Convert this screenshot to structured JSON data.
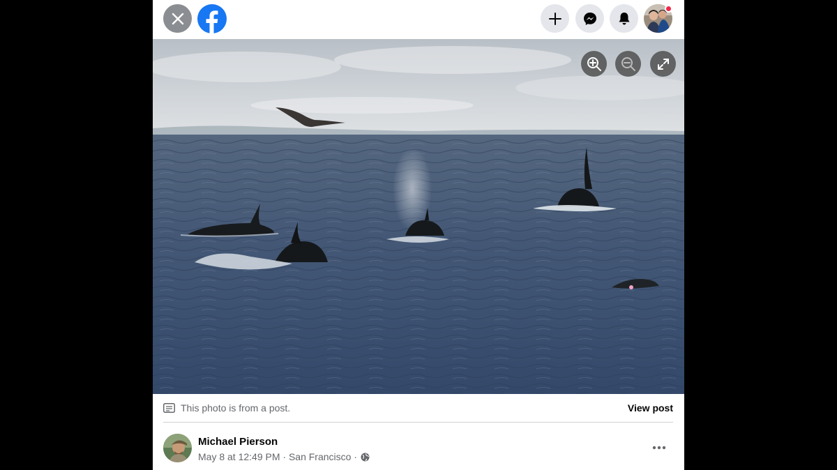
{
  "topbar": {
    "close_icon": "close-icon",
    "logo_icon": "facebook-logo",
    "create_icon": "plus-icon",
    "messenger_icon": "messenger-icon",
    "notifications_icon": "bell-icon",
    "profile_icon": "avatar",
    "colors": {
      "button_bg": "#e4e6eb",
      "close_bg": "#8a8d91",
      "brand": "#1877f2",
      "badge": "#f02849"
    }
  },
  "photo": {
    "controls": {
      "zoom_in_icon": "zoom-in-icon",
      "zoom_out_icon": "zoom-out-icon",
      "fullscreen_icon": "fullscreen-icon"
    }
  },
  "post": {
    "note": "This photo is from a post.",
    "view_post_label": "View post",
    "author_name": "Michael Pierson",
    "meta": "May 8 at 12:49 PM · San Francisco ·",
    "privacy_icon": "globe-icon",
    "more_icon": "more-options-icon"
  }
}
